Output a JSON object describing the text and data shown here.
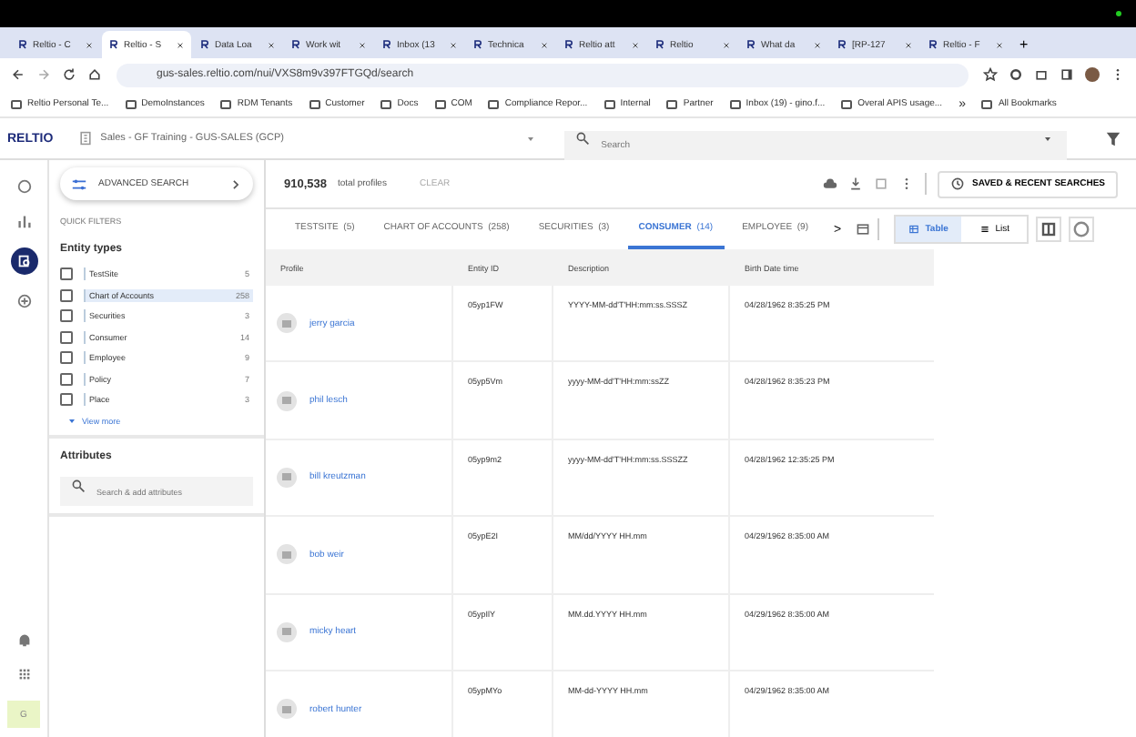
{
  "browser": {
    "tabs": [
      {
        "label": "Reltio - C",
        "selected": false
      },
      {
        "label": "Reltio - S",
        "selected": true
      },
      {
        "label": "Data Loa",
        "selected": false
      },
      {
        "label": "Work wit",
        "selected": false
      },
      {
        "label": "Inbox (13",
        "selected": false
      },
      {
        "label": "Technica",
        "selected": false
      },
      {
        "label": "Reltio att",
        "selected": false
      },
      {
        "label": "Reltio",
        "selected": false
      },
      {
        "label": "What da",
        "selected": false
      },
      {
        "label": "[RP-127",
        "selected": false
      },
      {
        "label": "Reltio - F",
        "selected": false
      }
    ],
    "new_tab": "+",
    "url": "gus-sales.reltio.com/nui/VXS8m9v397FTGQd/search",
    "bookmarks": [
      "Reltio Personal Te...",
      "DemoInstances",
      "RDM Tenants",
      "Customer",
      "Docs",
      "COM",
      "Compliance Repor...",
      "Internal",
      "Partner",
      "Inbox (19) - gino.f...",
      "Overal APIS usage..."
    ],
    "more_bookmarks": "»",
    "all_bookmarks": "All Bookmarks"
  },
  "app": {
    "logo": "RELTIO",
    "tenant": "Sales - GF Training - GUS-SALES (GCP)",
    "search": {
      "placeholder": "Search"
    }
  },
  "filters": {
    "advanced_search": "ADVANCED SEARCH",
    "quick_filters": "QUICK FILTERS",
    "entity_types_title": "Entity types",
    "entity_types": [
      {
        "label": "TestSite",
        "count": "5",
        "checked": false,
        "selected": false
      },
      {
        "label": "Chart of Accounts",
        "count": "258",
        "checked": false,
        "selected": true
      },
      {
        "label": "Securities",
        "count": "3",
        "checked": false,
        "selected": false
      },
      {
        "label": "Consumer",
        "count": "14",
        "checked": false,
        "selected": false
      },
      {
        "label": "Employee",
        "count": "9",
        "checked": false,
        "selected": false
      },
      {
        "label": "Policy",
        "count": "7",
        "checked": false,
        "selected": false
      },
      {
        "label": "Place",
        "count": "3",
        "checked": false,
        "selected": false
      }
    ],
    "view_more": "View more",
    "attributes_title": "Attributes",
    "attributes_search": {
      "placeholder": "Search & add attributes"
    }
  },
  "results": {
    "total": "910,538",
    "total_label": "total profiles",
    "clear": "CLEAR",
    "saved_searches": "SAVED & RECENT SEARCHES",
    "tabs": [
      {
        "label": "TESTSITE",
        "count": "(5)",
        "selected": false
      },
      {
        "label": "CHART OF ACCOUNTS",
        "count": "(258)",
        "selected": false
      },
      {
        "label": "SECURITIES",
        "count": "(3)",
        "selected": false
      },
      {
        "label": "CONSUMER",
        "count": "(14)",
        "selected": true
      },
      {
        "label": "EMPLOYEE",
        "count": "(9)",
        "selected": false
      }
    ],
    "tabs_next": ">",
    "views": [
      {
        "label": "Table",
        "selected": true
      },
      {
        "label": "List",
        "selected": false
      }
    ],
    "table": {
      "columns": [
        "Profile",
        "Entity ID",
        "Description",
        "Birth Date time"
      ],
      "rows": [
        {
          "name": "jerry garcia",
          "entity_id": "05yp1FW",
          "description": "YYYY-MM-dd'T'HH:mm:ss.SSSZ",
          "birth": "04/28/1962 8:35:25 PM"
        },
        {
          "name": "phil lesch",
          "entity_id": "05yp5Vm",
          "description": "yyyy-MM-dd'T'HH:mm:ssZZ",
          "birth": "04/28/1962 8:35:23 PM"
        },
        {
          "name": "bill kreutzman",
          "entity_id": "05yp9m2",
          "description": "yyyy-MM-dd'T'HH:mm:ss.SSSZZ",
          "birth": "04/28/1962 12:35:25 PM"
        },
        {
          "name": "bob weir",
          "entity_id": "05ypE2I",
          "description": "MM/dd/YYYY HH.mm",
          "birth": "04/29/1962 8:35:00 AM"
        },
        {
          "name": "micky heart",
          "entity_id": "05ypIlY",
          "description": "MM.dd.YYYY HH.mm",
          "birth": "04/29/1962 8:35:00 AM"
        },
        {
          "name": "robert hunter",
          "entity_id": "05ypMYo",
          "description": "MM-dd-YYYY HH.mm",
          "birth": "04/29/1962 8:35:00 AM"
        }
      ]
    }
  },
  "user": {
    "initial": "G"
  }
}
